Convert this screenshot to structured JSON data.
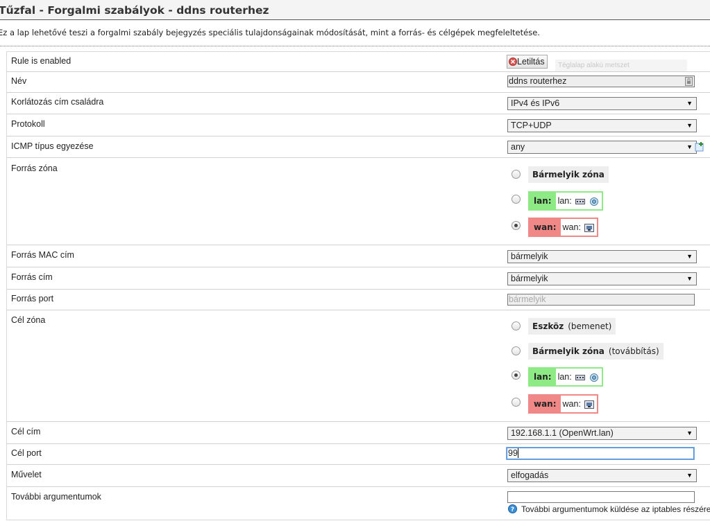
{
  "header": {
    "title": "Tűzfal - Forgalmi szabályok - ddns routerhez",
    "description": "Ez a lap lehetővé teszi a forgalmi szabály bejegyzés speciális tulajdonságainak módosítását, mint a forrás- és célgépek megfeleltetése."
  },
  "form": {
    "enabled": {
      "label": "Rule is enabled",
      "button": "Letiltás",
      "overlay": "Téglalap alakú metszet"
    },
    "name": {
      "label": "Név",
      "value": "ddns routerhez"
    },
    "family": {
      "label": "Korlátozás cím családra",
      "value": "IPv4 és IPv6"
    },
    "proto": {
      "label": "Protokoll",
      "value": "TCP+UDP"
    },
    "icmp": {
      "label": "ICMP típus egyezése",
      "value": "any"
    },
    "src_zone": {
      "label": "Forrás zóna",
      "any": "Bármelyik zóna",
      "lan_name": "lan:",
      "lan_inner": "lan:",
      "wan_name": "wan:",
      "wan_inner": "wan:"
    },
    "src_mac": {
      "label": "Forrás MAC cím",
      "value": "bármelyik"
    },
    "src_ip": {
      "label": "Forrás cím",
      "value": "bármelyik"
    },
    "src_port": {
      "label": "Forrás port",
      "placeholder": "bármelyik"
    },
    "dest_zone": {
      "label": "Cél zóna",
      "device": "Eszköz",
      "device_note": "(bemenet)",
      "any": "Bármelyik zóna",
      "any_note": "(továbbítás)",
      "lan_name": "lan:",
      "lan_inner": "lan:",
      "wan_name": "wan:",
      "wan_inner": "wan:"
    },
    "dest_ip": {
      "label": "Cél cím",
      "value": "192.168.1.1 (OpenWrt.lan)"
    },
    "dest_port": {
      "label": "Cél port",
      "value": "99"
    },
    "target": {
      "label": "Művelet",
      "value": "elfogadás"
    },
    "extra": {
      "label": "További argumentumok",
      "value": "",
      "hint": "További argumentumok küldése az iptables részére"
    }
  },
  "colors": {
    "lan_zone": "#8dea84",
    "wan_zone": "#f08888",
    "any_zone": "#eeeeee"
  }
}
